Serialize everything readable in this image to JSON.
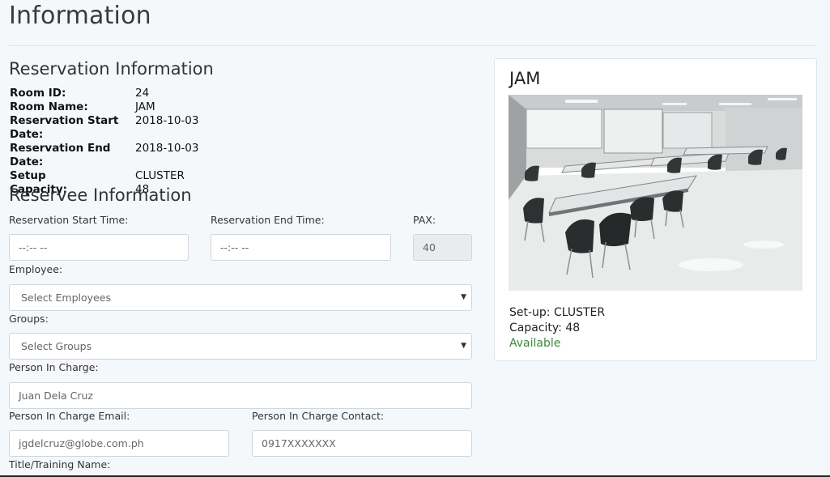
{
  "page": {
    "title": "Information"
  },
  "reservation_info": {
    "heading": "Reservation Information",
    "fields": [
      {
        "label": "Room ID:",
        "value": "24"
      },
      {
        "label": "Room Name:",
        "value": "JAM"
      },
      {
        "label": "Reservation Start Date:",
        "value": "2018-10-03"
      },
      {
        "label": "Reservation End Date:",
        "value": "2018-10-03"
      },
      {
        "label": "Setup",
        "value": "CLUSTER"
      },
      {
        "label": "Capacity:",
        "value": "48"
      }
    ]
  },
  "reservee_info": {
    "heading": "Reservee Information",
    "start_time": {
      "label": "Reservation Start Time:",
      "value": "--:-- --"
    },
    "end_time": {
      "label": "Reservation End Time:",
      "value": "--:-- --"
    },
    "pax": {
      "label": "PAX:",
      "value": "40"
    },
    "employee": {
      "label": "Employee:",
      "selected": "Select Employees"
    },
    "groups": {
      "label": "Groups:",
      "selected": "Select Groups"
    },
    "person_in_charge": {
      "label": "Person In Charge:",
      "value": "Juan Dela Cruz"
    },
    "pic_email": {
      "label": "Person In Charge Email:",
      "value": "jgdelcruz@globe.com.ph"
    },
    "pic_contact": {
      "label": "Person In Charge Contact:",
      "value": "0917XXXXXXX"
    },
    "title_training": {
      "label": "Title/Training Name:"
    }
  },
  "room_card": {
    "name": "JAM",
    "setup": "Set-up: CLUSTER",
    "capacity": "Capacity: 48",
    "status": "Available",
    "status_color": "#3a8b3a"
  }
}
